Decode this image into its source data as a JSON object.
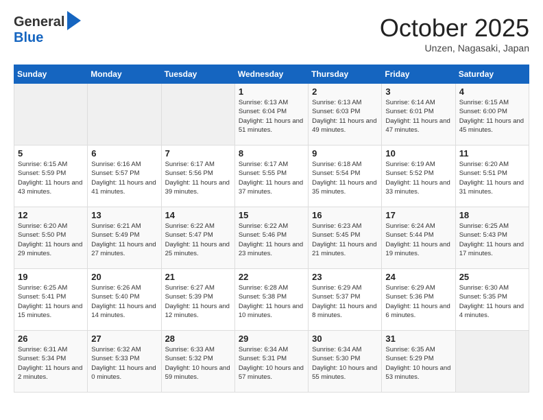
{
  "header": {
    "logo_line1": "General",
    "logo_line2": "Blue",
    "month": "October 2025",
    "location": "Unzen, Nagasaki, Japan"
  },
  "weekdays": [
    "Sunday",
    "Monday",
    "Tuesday",
    "Wednesday",
    "Thursday",
    "Friday",
    "Saturday"
  ],
  "weeks": [
    [
      {
        "day": "",
        "info": ""
      },
      {
        "day": "",
        "info": ""
      },
      {
        "day": "",
        "info": ""
      },
      {
        "day": "1",
        "info": "Sunrise: 6:13 AM\nSunset: 6:04 PM\nDaylight: 11 hours\nand 51 minutes."
      },
      {
        "day": "2",
        "info": "Sunrise: 6:13 AM\nSunset: 6:03 PM\nDaylight: 11 hours\nand 49 minutes."
      },
      {
        "day": "3",
        "info": "Sunrise: 6:14 AM\nSunset: 6:01 PM\nDaylight: 11 hours\nand 47 minutes."
      },
      {
        "day": "4",
        "info": "Sunrise: 6:15 AM\nSunset: 6:00 PM\nDaylight: 11 hours\nand 45 minutes."
      }
    ],
    [
      {
        "day": "5",
        "info": "Sunrise: 6:15 AM\nSunset: 5:59 PM\nDaylight: 11 hours\nand 43 minutes."
      },
      {
        "day": "6",
        "info": "Sunrise: 6:16 AM\nSunset: 5:57 PM\nDaylight: 11 hours\nand 41 minutes."
      },
      {
        "day": "7",
        "info": "Sunrise: 6:17 AM\nSunset: 5:56 PM\nDaylight: 11 hours\nand 39 minutes."
      },
      {
        "day": "8",
        "info": "Sunrise: 6:17 AM\nSunset: 5:55 PM\nDaylight: 11 hours\nand 37 minutes."
      },
      {
        "day": "9",
        "info": "Sunrise: 6:18 AM\nSunset: 5:54 PM\nDaylight: 11 hours\nand 35 minutes."
      },
      {
        "day": "10",
        "info": "Sunrise: 6:19 AM\nSunset: 5:52 PM\nDaylight: 11 hours\nand 33 minutes."
      },
      {
        "day": "11",
        "info": "Sunrise: 6:20 AM\nSunset: 5:51 PM\nDaylight: 11 hours\nand 31 minutes."
      }
    ],
    [
      {
        "day": "12",
        "info": "Sunrise: 6:20 AM\nSunset: 5:50 PM\nDaylight: 11 hours\nand 29 minutes."
      },
      {
        "day": "13",
        "info": "Sunrise: 6:21 AM\nSunset: 5:49 PM\nDaylight: 11 hours\nand 27 minutes."
      },
      {
        "day": "14",
        "info": "Sunrise: 6:22 AM\nSunset: 5:47 PM\nDaylight: 11 hours\nand 25 minutes."
      },
      {
        "day": "15",
        "info": "Sunrise: 6:22 AM\nSunset: 5:46 PM\nDaylight: 11 hours\nand 23 minutes."
      },
      {
        "day": "16",
        "info": "Sunrise: 6:23 AM\nSunset: 5:45 PM\nDaylight: 11 hours\nand 21 minutes."
      },
      {
        "day": "17",
        "info": "Sunrise: 6:24 AM\nSunset: 5:44 PM\nDaylight: 11 hours\nand 19 minutes."
      },
      {
        "day": "18",
        "info": "Sunrise: 6:25 AM\nSunset: 5:43 PM\nDaylight: 11 hours\nand 17 minutes."
      }
    ],
    [
      {
        "day": "19",
        "info": "Sunrise: 6:25 AM\nSunset: 5:41 PM\nDaylight: 11 hours\nand 15 minutes."
      },
      {
        "day": "20",
        "info": "Sunrise: 6:26 AM\nSunset: 5:40 PM\nDaylight: 11 hours\nand 14 minutes."
      },
      {
        "day": "21",
        "info": "Sunrise: 6:27 AM\nSunset: 5:39 PM\nDaylight: 11 hours\nand 12 minutes."
      },
      {
        "day": "22",
        "info": "Sunrise: 6:28 AM\nSunset: 5:38 PM\nDaylight: 11 hours\nand 10 minutes."
      },
      {
        "day": "23",
        "info": "Sunrise: 6:29 AM\nSunset: 5:37 PM\nDaylight: 11 hours\nand 8 minutes."
      },
      {
        "day": "24",
        "info": "Sunrise: 6:29 AM\nSunset: 5:36 PM\nDaylight: 11 hours\nand 6 minutes."
      },
      {
        "day": "25",
        "info": "Sunrise: 6:30 AM\nSunset: 5:35 PM\nDaylight: 11 hours\nand 4 minutes."
      }
    ],
    [
      {
        "day": "26",
        "info": "Sunrise: 6:31 AM\nSunset: 5:34 PM\nDaylight: 11 hours\nand 2 minutes."
      },
      {
        "day": "27",
        "info": "Sunrise: 6:32 AM\nSunset: 5:33 PM\nDaylight: 11 hours\nand 0 minutes."
      },
      {
        "day": "28",
        "info": "Sunrise: 6:33 AM\nSunset: 5:32 PM\nDaylight: 10 hours\nand 59 minutes."
      },
      {
        "day": "29",
        "info": "Sunrise: 6:34 AM\nSunset: 5:31 PM\nDaylight: 10 hours\nand 57 minutes."
      },
      {
        "day": "30",
        "info": "Sunrise: 6:34 AM\nSunset: 5:30 PM\nDaylight: 10 hours\nand 55 minutes."
      },
      {
        "day": "31",
        "info": "Sunrise: 6:35 AM\nSunset: 5:29 PM\nDaylight: 10 hours\nand 53 minutes."
      },
      {
        "day": "",
        "info": ""
      }
    ]
  ]
}
